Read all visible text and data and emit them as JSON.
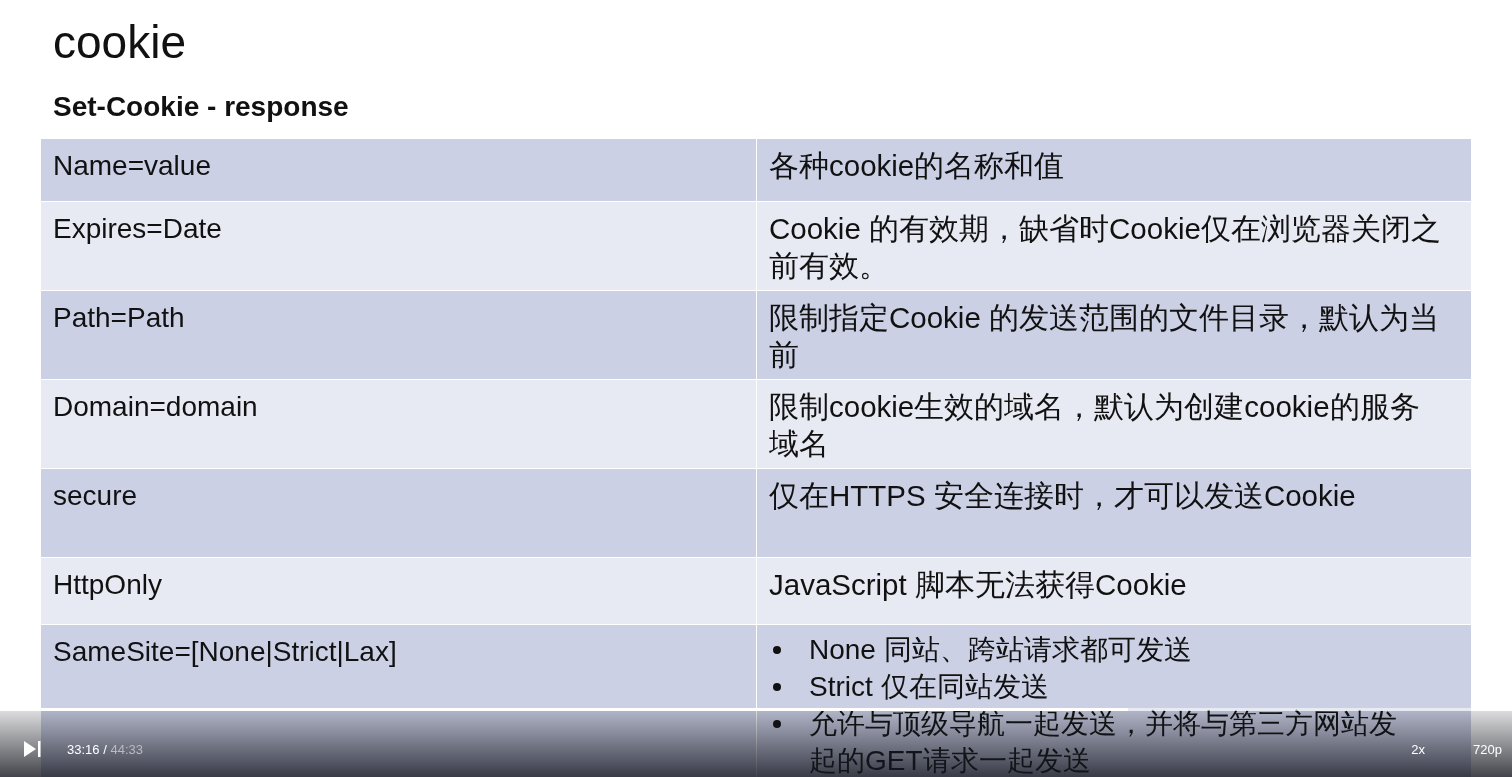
{
  "slide": {
    "title": "cookie",
    "subtitle": "Set-Cookie - response",
    "rows": [
      {
        "kind": "text",
        "name": "Name=value",
        "description": "各种cookie的名称和值"
      },
      {
        "kind": "text",
        "name": "Expires=Date",
        "description": "Cookie 的有效期，缺省时Cookie仅在浏览器关闭之前有效。"
      },
      {
        "kind": "text",
        "name": "Path=Path",
        "description": "限制指定Cookie 的发送范围的文件目录，默认为当前"
      },
      {
        "kind": "text",
        "name": "Domain=domain",
        "description": "限制cookie生效的域名，默认为创建cookie的服务域名"
      },
      {
        "kind": "text",
        "name": "secure",
        "description": "仅在HTTPS 安全连接时，才可以发送Cookie"
      },
      {
        "kind": "text",
        "name": "HttpOnly",
        "description": "JavaScript 脚本无法获得Cookie"
      },
      {
        "kind": "bullets",
        "name": "SameSite=[None|Strict|Lax]",
        "bullets": [
          "None 同站、跨站请求都可发送",
          "Strict 仅在同站发送",
          "允许与顶级导航一起发送，并将与第三方网站发起的GET请求一起发送"
        ]
      }
    ]
  },
  "player": {
    "playing": false,
    "current_time": "33:16",
    "time_separator": "/",
    "duration": "44:33",
    "progress": {
      "level": 0.746
    },
    "speed": "2x",
    "quality": "720p"
  }
}
